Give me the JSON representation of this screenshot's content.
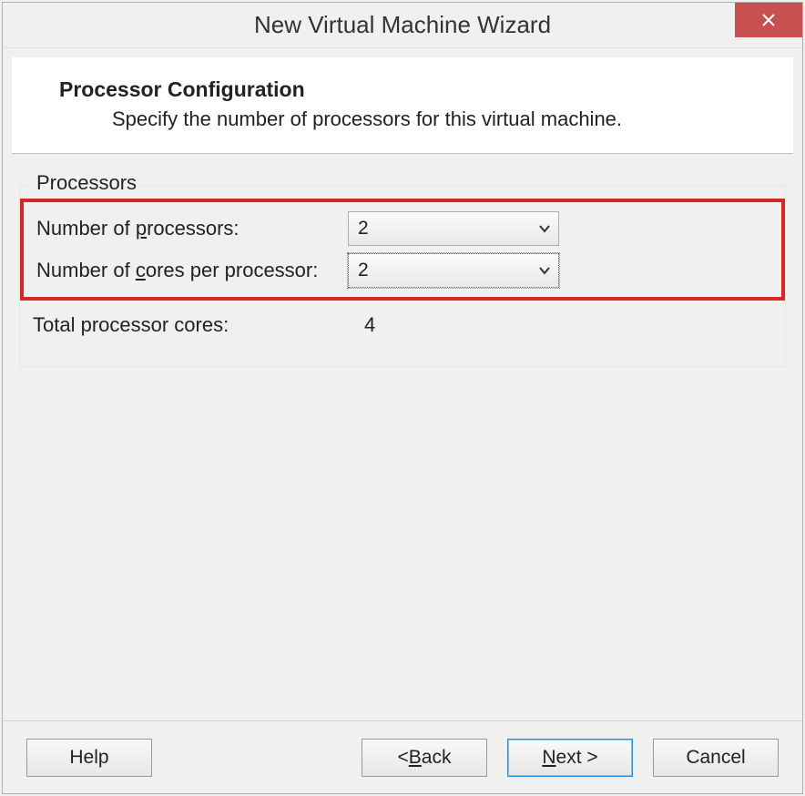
{
  "window": {
    "title": "New Virtual Machine Wizard"
  },
  "header": {
    "title": "Processor Configuration",
    "subtitle": "Specify the number of processors for this virtual machine."
  },
  "group": {
    "legend": "Processors",
    "processors_label_pre": "Number of ",
    "processors_label_mn": "p",
    "processors_label_post": "rocessors:",
    "processors_value": "2",
    "cores_label_pre": "Number of ",
    "cores_label_mn": "c",
    "cores_label_post": "ores per processor:",
    "cores_value": "2",
    "total_label": "Total processor cores:",
    "total_value": "4"
  },
  "buttons": {
    "help": "Help",
    "back_pre": "< ",
    "back_mn": "B",
    "back_post": "ack",
    "next_mn": "N",
    "next_post": "ext >",
    "cancel": "Cancel"
  }
}
